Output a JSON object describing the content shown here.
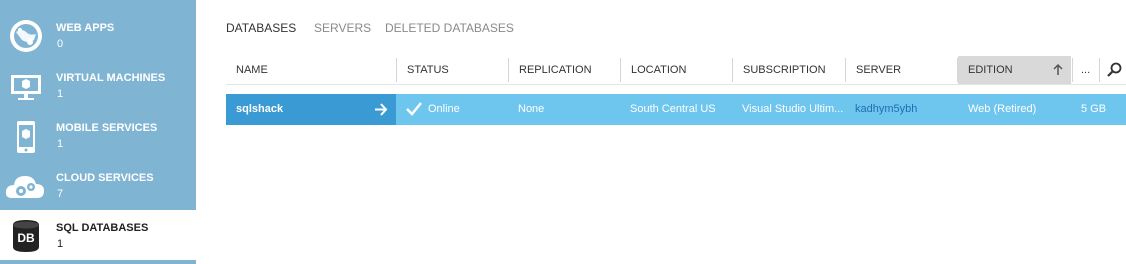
{
  "sidebar": {
    "items": [
      {
        "label": "WEB APPS",
        "count": "0",
        "icon": "globe-icon"
      },
      {
        "label": "VIRTUAL MACHINES",
        "count": "1",
        "icon": "monitor-icon"
      },
      {
        "label": "MOBILE SERVICES",
        "count": "1",
        "icon": "phone-icon"
      },
      {
        "label": "CLOUD SERVICES",
        "count": "7",
        "icon": "cloud-gear-icon"
      },
      {
        "label": "SQL DATABASES",
        "count": "1",
        "icon": "database-icon",
        "active": true,
        "badge": "DB"
      }
    ]
  },
  "tabs": [
    {
      "label": "DATABASES",
      "active": true
    },
    {
      "label": "SERVERS",
      "active": false
    },
    {
      "label": "DELETED DATABASES",
      "active": false
    }
  ],
  "table": {
    "columns": [
      "NAME",
      "STATUS",
      "REPLICATION",
      "LOCATION",
      "SUBSCRIPTION",
      "SERVER",
      "EDITION",
      "..."
    ],
    "rows": [
      {
        "name": "sqlshack",
        "status": "Online",
        "replication": "None",
        "location": "South Central US",
        "subscription": "Visual Studio Ultim...",
        "server": "kadhym5ybh",
        "edition": "Web (Retired)",
        "size": "5 GB"
      }
    ]
  },
  "colors": {
    "sidebar_bg": "#7fb4d3",
    "row_highlight": "#6ec6ee",
    "row_name_cell": "#3a9ad3",
    "server_link": "#1f6fb0"
  }
}
